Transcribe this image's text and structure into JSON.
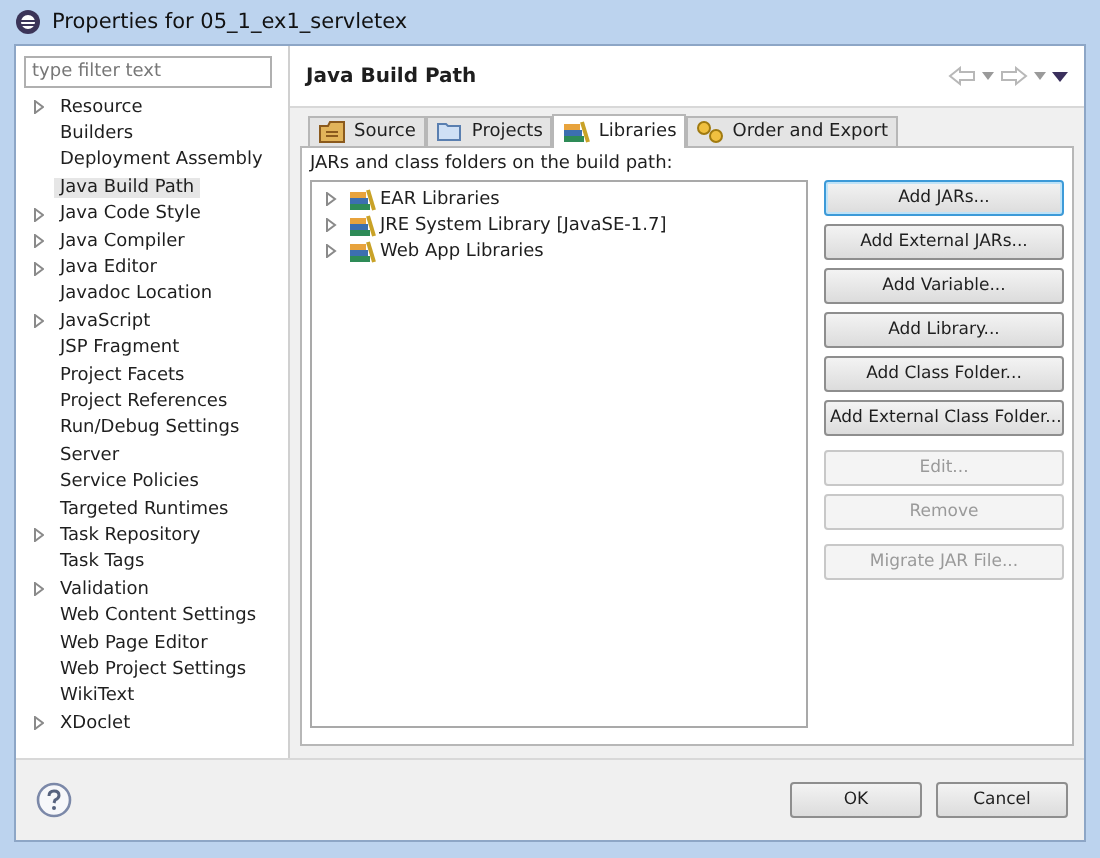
{
  "window": {
    "title": "Properties for 05_1_ex1_servletex"
  },
  "sidebar": {
    "filter": {
      "placeholder": "type filter text"
    },
    "items": [
      {
        "label": "Resource",
        "expandable": true,
        "selected": false
      },
      {
        "label": "Builders",
        "expandable": false,
        "selected": false
      },
      {
        "label": "Deployment Assembly",
        "expandable": false,
        "selected": false
      },
      {
        "label": "Java Build Path",
        "expandable": false,
        "selected": true
      },
      {
        "label": "Java Code Style",
        "expandable": true,
        "selected": false
      },
      {
        "label": "Java Compiler",
        "expandable": true,
        "selected": false
      },
      {
        "label": "Java Editor",
        "expandable": true,
        "selected": false
      },
      {
        "label": "Javadoc Location",
        "expandable": false,
        "selected": false
      },
      {
        "label": "JavaScript",
        "expandable": true,
        "selected": false
      },
      {
        "label": "JSP Fragment",
        "expandable": false,
        "selected": false
      },
      {
        "label": "Project Facets",
        "expandable": false,
        "selected": false
      },
      {
        "label": "Project References",
        "expandable": false,
        "selected": false
      },
      {
        "label": "Run/Debug Settings",
        "expandable": false,
        "selected": false
      },
      {
        "label": "Server",
        "expandable": false,
        "selected": false
      },
      {
        "label": "Service Policies",
        "expandable": false,
        "selected": false
      },
      {
        "label": "Targeted Runtimes",
        "expandable": false,
        "selected": false
      },
      {
        "label": "Task Repository",
        "expandable": true,
        "selected": false
      },
      {
        "label": "Task Tags",
        "expandable": false,
        "selected": false
      },
      {
        "label": "Validation",
        "expandable": true,
        "selected": false
      },
      {
        "label": "Web Content Settings",
        "expandable": false,
        "selected": false
      },
      {
        "label": "Web Page Editor",
        "expandable": false,
        "selected": false
      },
      {
        "label": "Web Project Settings",
        "expandable": false,
        "selected": false
      },
      {
        "label": "WikiText",
        "expandable": false,
        "selected": false
      },
      {
        "label": "XDoclet",
        "expandable": true,
        "selected": false
      }
    ]
  },
  "page": {
    "title": "Java Build Path",
    "tabs": [
      {
        "label": "Source",
        "selected": false
      },
      {
        "label": "Projects",
        "selected": false
      },
      {
        "label": "Libraries",
        "selected": true
      },
      {
        "label": "Order and Export",
        "selected": false
      }
    ],
    "caption": "JARs and class folders on the build path:",
    "tree": [
      {
        "label": "EAR Libraries",
        "expanded": false
      },
      {
        "label": "JRE System Library [JavaSE-1.7]",
        "expanded": false
      },
      {
        "label": "Web App Libraries",
        "expanded": false
      }
    ],
    "button_groups": [
      [
        {
          "label": "Add JARs...",
          "disabled": false,
          "focused": true
        },
        {
          "label": "Add External JARs...",
          "disabled": false,
          "focused": false
        },
        {
          "label": "Add Variable...",
          "disabled": false,
          "focused": false
        },
        {
          "label": "Add Library...",
          "disabled": false,
          "focused": false
        },
        {
          "label": "Add Class Folder...",
          "disabled": false,
          "focused": false
        },
        {
          "label": "Add External Class Folder...",
          "disabled": false,
          "focused": false
        }
      ],
      [
        {
          "label": "Edit...",
          "disabled": true,
          "focused": false
        },
        {
          "label": "Remove",
          "disabled": true,
          "focused": false
        }
      ],
      [
        {
          "label": "Migrate JAR File...",
          "disabled": true,
          "focused": false
        }
      ]
    ]
  },
  "footer": {
    "buttons": [
      "OK",
      "Cancel"
    ]
  }
}
